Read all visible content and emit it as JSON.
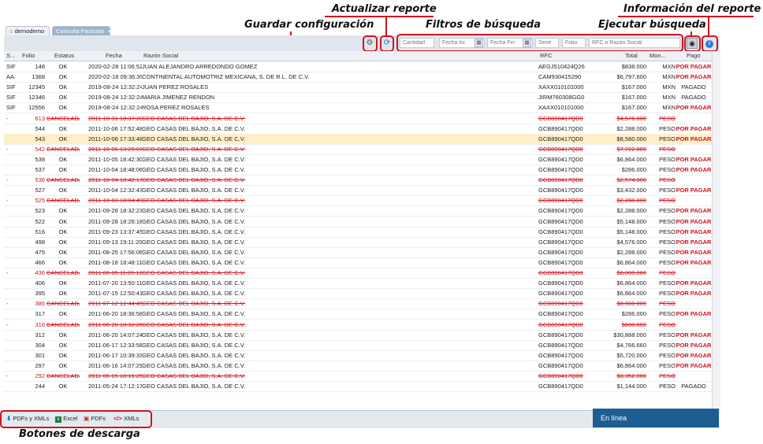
{
  "callouts": {
    "actualizar": "Actualizar reporte",
    "informacion": "Información del reporte",
    "guardar": "Guardar configuración",
    "filtros": "Filtros de búsqueda",
    "ejecutar": "Ejecutar búsqueda",
    "descarga": "Botones de descarga"
  },
  "tabs": {
    "home": "demodemo",
    "active": "Consulta Facturas",
    "close": "×"
  },
  "filters": {
    "cantidad": "Cantidad",
    "fecha_ini": "Fecha Ini",
    "fecha_fin": "Fecha Fin",
    "serie": "Serie",
    "folio": "Folio",
    "rfc_razon": "RFC o Razón Social"
  },
  "columns": {
    "serie": "S...",
    "folio": "Folio",
    "estatus": "Estatus",
    "fecha": "Fecha",
    "razon": "Razón Social",
    "rfc": "RFC",
    "total": "Total",
    "moneda": "Mon...",
    "pago": "Pago"
  },
  "rows": [
    {
      "serie": "SIF",
      "folio": "148",
      "estatus": "OK",
      "fecha": "2020-02-28 11:06:52",
      "razon": "JUAN ALEJANDRO ARREDONDO GOMEZ",
      "rfc": "AEGJ510424Q26",
      "total": "$838.000",
      "moneda": "MXN",
      "pago": "POR PAGAR",
      "cancel": false
    },
    {
      "serie": "AA",
      "folio": "1368",
      "estatus": "OK",
      "fecha": "2020-02-18 09:36:39",
      "razon": "CONTINENTAL AUTOMOTRIZ MEXICANA, S. DE R.L. DE C.V.",
      "rfc": "CAM930415290",
      "total": "$6,797.600",
      "moneda": "MXN",
      "pago": "POR PAGAR",
      "cancel": false
    },
    {
      "serie": "SIF",
      "folio": "12345",
      "estatus": "OK",
      "fecha": "2019-08-24 12:32:24",
      "razon": "JUAN PEREZ ROSALES",
      "rfc": "XAXX010101000",
      "total": "$167.000",
      "moneda": "MXN",
      "pago": "PAGADO",
      "cancel": false
    },
    {
      "serie": "SIF",
      "folio": "12346",
      "estatus": "OK",
      "fecha": "2019-08-24 12:32:24",
      "razon": "MARIA JIMENEZ RENDON",
      "rfc": "JIRM760308GG0",
      "total": "$167.000",
      "moneda": "MXN",
      "pago": "PAGADO",
      "cancel": false
    },
    {
      "serie": "SIF",
      "folio": "12556",
      "estatus": "OK",
      "fecha": "2019-08-24 12:32:24",
      "razon": "ROSA PEREZ ROSALES",
      "rfc": "XAXX010101000",
      "total": "$167.000",
      "moneda": "MXN",
      "pago": "POR PAGAR",
      "cancel": false
    },
    {
      "serie": "-",
      "folio": "613",
      "estatus": "CANCELADA",
      "fecha": "2011-10-31 18:37:20",
      "razon": "GEO CASAS DEL BAJIO, S.A. DE C.V.",
      "rfc": "GCB890417QD0",
      "total": "$4,576.000",
      "moneda": "PESO",
      "pago": "",
      "cancel": true
    },
    {
      "serie": "",
      "folio": "544",
      "estatus": "OK",
      "fecha": "2011-10-06 17:52:48",
      "razon": "GEO CASAS DEL BAJIO, S.A. DE C.V.",
      "rfc": "GCB890417QD0",
      "total": "$2,288.000",
      "moneda": "PESO",
      "pago": "POR PAGAR",
      "cancel": false
    },
    {
      "serie": "",
      "folio": "543",
      "estatus": "OK",
      "fecha": "2011-10-06 17:33:48",
      "razon": "GEO CASAS DEL BAJIO, S.A. DE C.V.",
      "rfc": "GCB890417QD0",
      "total": "$8,580.000",
      "moneda": "PESO",
      "pago": "POR PAGAR",
      "cancel": false,
      "selected": true
    },
    {
      "serie": "-",
      "folio": "542",
      "estatus": "CANCELADA",
      "fecha": "2011-10-06 13:29:07",
      "razon": "GEO CASAS DEL BAJIO, S.A. DE C.V.",
      "rfc": "GCB890417QD0",
      "total": "$7,722.000",
      "moneda": "PESO",
      "pago": "",
      "cancel": true
    },
    {
      "serie": "",
      "folio": "538",
      "estatus": "OK",
      "fecha": "2011-10-05 18:42:30",
      "razon": "GEO CASAS DEL BAJIO, S.A. DE C.V.",
      "rfc": "GCB890417QD0",
      "total": "$6,864.000",
      "moneda": "PESO",
      "pago": "POR PAGAR",
      "cancel": false
    },
    {
      "serie": "",
      "folio": "537",
      "estatus": "OK",
      "fecha": "2011-10-04 18:48:06",
      "razon": "GEO CASAS DEL BAJIO, S.A. DE C.V.",
      "rfc": "GCB890417QD0",
      "total": "$286.000",
      "moneda": "PESO",
      "pago": "POR PAGAR",
      "cancel": false
    },
    {
      "serie": "-",
      "folio": "536",
      "estatus": "CANCELADA",
      "fecha": "2011-10-04 18:42:17",
      "razon": "GEO CASAS DEL BAJIO, S.A. DE C.V.",
      "rfc": "GCB890417QD0",
      "total": "$2,574.000",
      "moneda": "PESO",
      "pago": "",
      "cancel": true
    },
    {
      "serie": "",
      "folio": "527",
      "estatus": "OK",
      "fecha": "2011-10-04 12:32:43",
      "razon": "GEO CASAS DEL BAJIO, S.A. DE C.V.",
      "rfc": "GCB890417QD0",
      "total": "$3,432.000",
      "moneda": "PESO",
      "pago": "POR PAGAR",
      "cancel": false
    },
    {
      "serie": "-",
      "folio": "525",
      "estatus": "CANCELADA",
      "fecha": "2011-10-03 18:04:49",
      "razon": "GEO CASAS DEL BAJIO, S.A. DE C.V.",
      "rfc": "GCB890417QD0",
      "total": "$2,288.000",
      "moneda": "PESO",
      "pago": "",
      "cancel": true
    },
    {
      "serie": "",
      "folio": "523",
      "estatus": "OK",
      "fecha": "2011-09-28 18:32:23",
      "razon": "GEO CASAS DEL BAJIO, S.A. DE C.V.",
      "rfc": "GCB890417QD0",
      "total": "$2,288.000",
      "moneda": "PESO",
      "pago": "POR PAGAR",
      "cancel": false
    },
    {
      "serie": "",
      "folio": "522",
      "estatus": "OK",
      "fecha": "2011-09-28 18:26:18",
      "razon": "GEO CASAS DEL BAJIO, S.A. DE C.V.",
      "rfc": "GCB890417QD0",
      "total": "$5,148.000",
      "moneda": "PESO",
      "pago": "POR PAGAR",
      "cancel": false
    },
    {
      "serie": "",
      "folio": "516",
      "estatus": "OK",
      "fecha": "2011-09-23 13:37:45",
      "razon": "GEO CASAS DEL BAJIO, S.A. DE C.V.",
      "rfc": "GCB890417QD0",
      "total": "$5,148.000",
      "moneda": "PESO",
      "pago": "POR PAGAR",
      "cancel": false
    },
    {
      "serie": "",
      "folio": "498",
      "estatus": "OK",
      "fecha": "2011-09-13 19:11:20",
      "razon": "GEO CASAS DEL BAJIO, S.A. DE C.V.",
      "rfc": "GCB890417QD0",
      "total": "$4,576.000",
      "moneda": "PESO",
      "pago": "POR PAGAR",
      "cancel": false
    },
    {
      "serie": "",
      "folio": "475",
      "estatus": "OK",
      "fecha": "2011-08-25 17:56:06",
      "razon": "GEO CASAS DEL BAJIO, S.A. DE C.V.",
      "rfc": "GCB890417QD0",
      "total": "$2,288.000",
      "moneda": "PESO",
      "pago": "POR PAGAR",
      "cancel": false
    },
    {
      "serie": "",
      "folio": "466",
      "estatus": "OK",
      "fecha": "2011-08-18 18:48:11",
      "razon": "GEO CASAS DEL BAJIO, S.A. DE C.V.",
      "rfc": "GCB890417QD0",
      "total": "$6,864.000",
      "moneda": "PESO",
      "pago": "POR PAGAR",
      "cancel": false
    },
    {
      "serie": "-",
      "folio": "436",
      "estatus": "CANCELADA",
      "fecha": "2011-08-05 11:09:12",
      "razon": "GEO CASAS DEL BAJIO, S.A. DE C.V.",
      "rfc": "GCB890417QD0",
      "total": "$8,008.000",
      "moneda": "PESO",
      "pago": "",
      "cancel": true
    },
    {
      "serie": "",
      "folio": "406",
      "estatus": "OK",
      "fecha": "2011-07-20 13:50:11",
      "razon": "GEO CASAS DEL BAJIO, S.A. DE C.V.",
      "rfc": "GCB890417QD0",
      "total": "$6,864.000",
      "moneda": "PESO",
      "pago": "POR PAGAR",
      "cancel": false
    },
    {
      "serie": "",
      "folio": "395",
      "estatus": "OK",
      "fecha": "2011-07-15 12:50:41",
      "razon": "GEO CASAS DEL BAJIO, S.A. DE C.V.",
      "rfc": "GCB890417QD0",
      "total": "$6,864.000",
      "moneda": "PESO",
      "pago": "POR PAGAR",
      "cancel": false
    },
    {
      "serie": "-",
      "folio": "386",
      "estatus": "CANCELADA",
      "fecha": "2011-07-12 12:44:45",
      "razon": "GEO CASAS DEL BAJIO, S.A. DE C.V.",
      "rfc": "GCB890417QD0",
      "total": "$8,008.000",
      "moneda": "PESO",
      "pago": "",
      "cancel": true
    },
    {
      "serie": "",
      "folio": "317",
      "estatus": "OK",
      "fecha": "2011-06-20 18:36:58",
      "razon": "GEO CASAS DEL BAJIO, S.A. DE C.V.",
      "rfc": "GCB890417QD0",
      "total": "$286.000",
      "moneda": "PESO",
      "pago": "POR PAGAR",
      "cancel": false
    },
    {
      "serie": "-",
      "folio": "316",
      "estatus": "CANCELADA",
      "fecha": "2011-06-20 18:32:26",
      "razon": "GEO CASAS DEL BAJIO, S.A. DE C.V.",
      "rfc": "GCB890417QD0",
      "total": "$600.600",
      "moneda": "PESO",
      "pago": "",
      "cancel": true
    },
    {
      "serie": "",
      "folio": "312",
      "estatus": "OK",
      "fecha": "2011-06-20 14:07:24",
      "razon": "GEO CASAS DEL BAJIO, S.A. DE C.V.",
      "rfc": "GCB890417QD0",
      "total": "$30,888.000",
      "moneda": "PESO",
      "pago": "POR PAGAR",
      "cancel": false
    },
    {
      "serie": "",
      "folio": "304",
      "estatus": "OK",
      "fecha": "2011-06-17 12:33:58",
      "razon": "GEO CASAS DEL BAJIO, S.A. DE C.V.",
      "rfc": "GCB890417QD0",
      "total": "$4,766.660",
      "moneda": "PESO",
      "pago": "POR PAGAR",
      "cancel": false
    },
    {
      "serie": "",
      "folio": "301",
      "estatus": "OK",
      "fecha": "2011-06-17 10:39:33",
      "razon": "GEO CASAS DEL BAJIO, S.A. DE C.V.",
      "rfc": "GCB890417QD0",
      "total": "$5,720.000",
      "moneda": "PESO",
      "pago": "POR PAGAR",
      "cancel": false
    },
    {
      "serie": "",
      "folio": "297",
      "estatus": "OK",
      "fecha": "2011-06-16 14:07:29",
      "razon": "GEO CASAS DEL BAJIO, S.A. DE C.V.",
      "rfc": "GCB890417QD0",
      "total": "$6,864.000",
      "moneda": "PESO",
      "pago": "POR PAGAR",
      "cancel": false
    },
    {
      "serie": "-",
      "folio": "292",
      "estatus": "CANCELADA",
      "fecha": "2011-06-15 18:16:25",
      "razon": "GEO CASAS DEL BAJIO, S.A. DE C.V.",
      "rfc": "GCB890417QD0",
      "total": "$8,352.000",
      "moneda": "PESO",
      "pago": "",
      "cancel": true
    },
    {
      "serie": "",
      "folio": "244",
      "estatus": "OK",
      "fecha": "2011-05-24 17:12:17",
      "razon": "GEO CASAS DEL BAJIO, S.A. DE C.V.",
      "rfc": "GCB890417QD0",
      "total": "$1,144.000",
      "moneda": "PESO",
      "pago": "PAGADO",
      "cancel": false
    }
  ],
  "downloads": {
    "pdfs_xmls": "PDFs y XMLs",
    "excel": "Excel",
    "pdfs": "PDFs",
    "xmls": "XMLs",
    "xml_icon_glyph": "</>"
  },
  "status": {
    "online": "En línea"
  },
  "colors": {
    "accent_red": "#d0141e",
    "header_blue": "#9db4cc",
    "online_blue": "#1d5e92"
  },
  "icons": {
    "home": "home-icon",
    "close": "close-icon",
    "settings": "gear-icon",
    "refresh": "refresh-icon",
    "calendar": "calendar-icon",
    "search": "binoculars-icon",
    "info": "info-icon",
    "download": "download-icon",
    "excel": "excel-icon",
    "pdf": "pdf-icon",
    "xml": "xml-icon"
  }
}
